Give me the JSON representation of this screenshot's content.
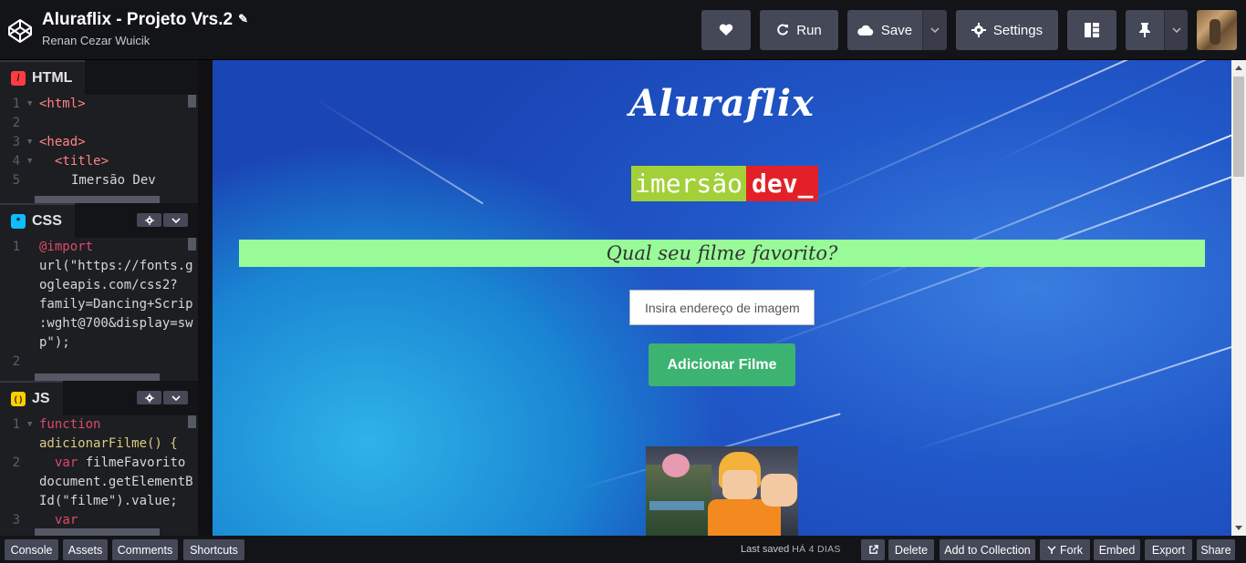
{
  "header": {
    "title": "Aluraflix - Projeto Vrs.2",
    "author": "Renan Cezar Wuicik",
    "buttons": {
      "run": "Run",
      "save": "Save",
      "settings": "Settings"
    }
  },
  "editors": {
    "html": {
      "label": "HTML",
      "icon": "/",
      "lines": [
        {
          "n": "1",
          "fold": true
        },
        {
          "n": "2"
        },
        {
          "n": "3",
          "fold": true
        },
        {
          "n": "4",
          "fold": true
        },
        {
          "n": "5"
        }
      ],
      "text": {
        "l1": "<html>",
        "l3": "<head>",
        "l4": "<title>",
        "l5": "Imersão Dev"
      }
    },
    "css": {
      "label": "CSS",
      "icon": "*",
      "text": {
        "l1a": "@import",
        "l1b": "url(\"https://fonts.g",
        "l1c": "ogleapis.com/css2?",
        "l1d": "family=Dancing+Scrip",
        "l1e": ":wght@700&display=sw",
        "l1f": "p\");"
      },
      "line_numbers": [
        "1",
        "2"
      ]
    },
    "js": {
      "label": "JS",
      "icon": "( )",
      "text": {
        "l1a": "function",
        "l1b": "adicionarFilme() {",
        "l2a": "var",
        "l2b": " filmeFavorito",
        "l2c": "document.getElementB",
        "l2d": "Id(\"filme\").value;",
        "l3a": "var"
      },
      "line_numbers": [
        "1",
        "2",
        "3"
      ]
    }
  },
  "preview": {
    "site_title": "Aluraflix",
    "brand_left": "imersão",
    "brand_right": "dev_",
    "question": "Qual seu filme favorito?",
    "input_placeholder": "Insira endereço de imagem",
    "add_button": "Adicionar Filme"
  },
  "footer": {
    "console": "Console",
    "assets": "Assets",
    "comments": "Comments",
    "shortcuts": "Shortcuts",
    "last_saved_label": "Last saved",
    "last_saved_ago": "HÁ 4 DIAS",
    "delete": "Delete",
    "add_to_collection": "Add to Collection",
    "fork": "Fork",
    "embed": "Embed",
    "export": "Export",
    "share": "Share"
  },
  "colors": {
    "html_icon": "#ff3c41",
    "css_icon": "#0ebeff",
    "js_icon": "#fcd000",
    "question_bg": "#98fb98",
    "add_button_bg": "#3cb371",
    "brand_green": "#a3d039",
    "brand_red": "#e32028"
  },
  "icons": [
    "codepen-logo-icon",
    "pencil-icon",
    "heart-icon",
    "refresh-icon",
    "cloud-icon",
    "chevron-down-icon",
    "gear-icon",
    "layout-icon",
    "pin-icon",
    "external-link-icon",
    "fork-icon"
  ]
}
